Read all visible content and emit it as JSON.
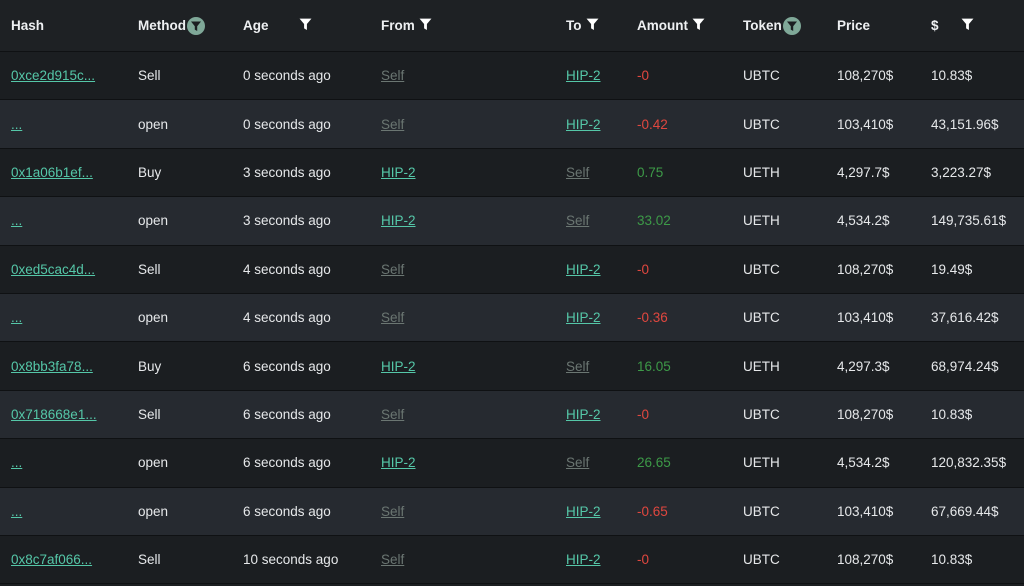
{
  "header": {
    "hash": "Hash",
    "method": "Method",
    "age": "Age",
    "from": "From",
    "to": "To",
    "amount": "Amount",
    "token": "Token",
    "price": "Price",
    "usd": "$"
  },
  "rows": [
    {
      "hash": "0xce2d915c...",
      "method": "Sell",
      "age": "0 seconds ago",
      "from": "Self",
      "to": "HIP-2",
      "amount": "-0",
      "token": "UBTC",
      "price": "108,270$",
      "usd": "10.83$"
    },
    {
      "hash": "...",
      "method": "open",
      "age": "0 seconds ago",
      "from": "Self",
      "to": "HIP-2",
      "amount": "-0.42",
      "token": "UBTC",
      "price": "103,410$",
      "usd": "43,151.96$"
    },
    {
      "hash": "0x1a06b1ef...",
      "method": "Buy",
      "age": "3 seconds ago",
      "from": "HIP-2",
      "to": "Self",
      "amount": "0.75",
      "token": "UETH",
      "price": "4,297.7$",
      "usd": "3,223.27$"
    },
    {
      "hash": "...",
      "method": "open",
      "age": "3 seconds ago",
      "from": "HIP-2",
      "to": "Self",
      "amount": "33.02",
      "token": "UETH",
      "price": "4,534.2$",
      "usd": "149,735.61$"
    },
    {
      "hash": "0xed5cac4d...",
      "method": "Sell",
      "age": "4 seconds ago",
      "from": "Self",
      "to": "HIP-2",
      "amount": "-0",
      "token": "UBTC",
      "price": "108,270$",
      "usd": "19.49$"
    },
    {
      "hash": "...",
      "method": "open",
      "age": "4 seconds ago",
      "from": "Self",
      "to": "HIP-2",
      "amount": "-0.36",
      "token": "UBTC",
      "price": "103,410$",
      "usd": "37,616.42$"
    },
    {
      "hash": "0x8bb3fa78...",
      "method": "Buy",
      "age": "6 seconds ago",
      "from": "HIP-2",
      "to": "Self",
      "amount": "16.05",
      "token": "UETH",
      "price": "4,297.3$",
      "usd": "68,974.24$"
    },
    {
      "hash": "0x718668e1...",
      "method": "Sell",
      "age": "6 seconds ago",
      "from": "Self",
      "to": "HIP-2",
      "amount": "-0",
      "token": "UBTC",
      "price": "108,270$",
      "usd": "10.83$"
    },
    {
      "hash": "...",
      "method": "open",
      "age": "6 seconds ago",
      "from": "HIP-2",
      "to": "Self",
      "amount": "26.65",
      "token": "UETH",
      "price": "4,534.2$",
      "usd": "120,832.35$"
    },
    {
      "hash": "...",
      "method": "open",
      "age": "6 seconds ago",
      "from": "Self",
      "to": "HIP-2",
      "amount": "-0.65",
      "token": "UBTC",
      "price": "103,410$",
      "usd": "67,669.44$"
    },
    {
      "hash": "0x8c7af066...",
      "method": "Sell",
      "age": "10 seconds ago",
      "from": "Self",
      "to": "HIP-2",
      "amount": "-0",
      "token": "UBTC",
      "price": "108,270$",
      "usd": "10.83$"
    }
  ],
  "colors": {
    "link": "#55c7a8",
    "self": "#6b7672",
    "negative": "#e0473f",
    "positive": "#3d9a48",
    "row_alt": "#262a30",
    "row_base": "#1b1e21"
  },
  "icons": {
    "filter": "filter-icon",
    "filter_active": "filter-active-icon"
  }
}
